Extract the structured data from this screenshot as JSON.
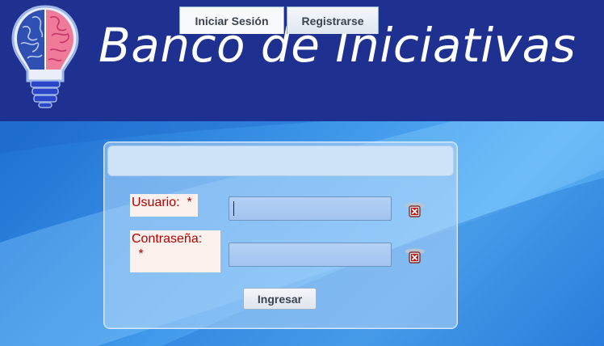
{
  "header": {
    "title": "Banco de Iniciativas",
    "logo": "lightbulb-brain-logo"
  },
  "tabs": [
    {
      "label": "Iniciar Sesión",
      "active": true
    },
    {
      "label": "Registrarse",
      "active": false
    }
  ],
  "form": {
    "username_label": "Usuario:  *",
    "password_label_line1": "Contraseña:",
    "password_label_line2": " *",
    "username_value": "",
    "password_value": "",
    "clear_icon": "clear-x-icon",
    "submit_label": "Ingresar"
  },
  "colors": {
    "header_bg": "#1f3190",
    "label_text": "#b30000",
    "label_bg": "#fdf1ee"
  }
}
